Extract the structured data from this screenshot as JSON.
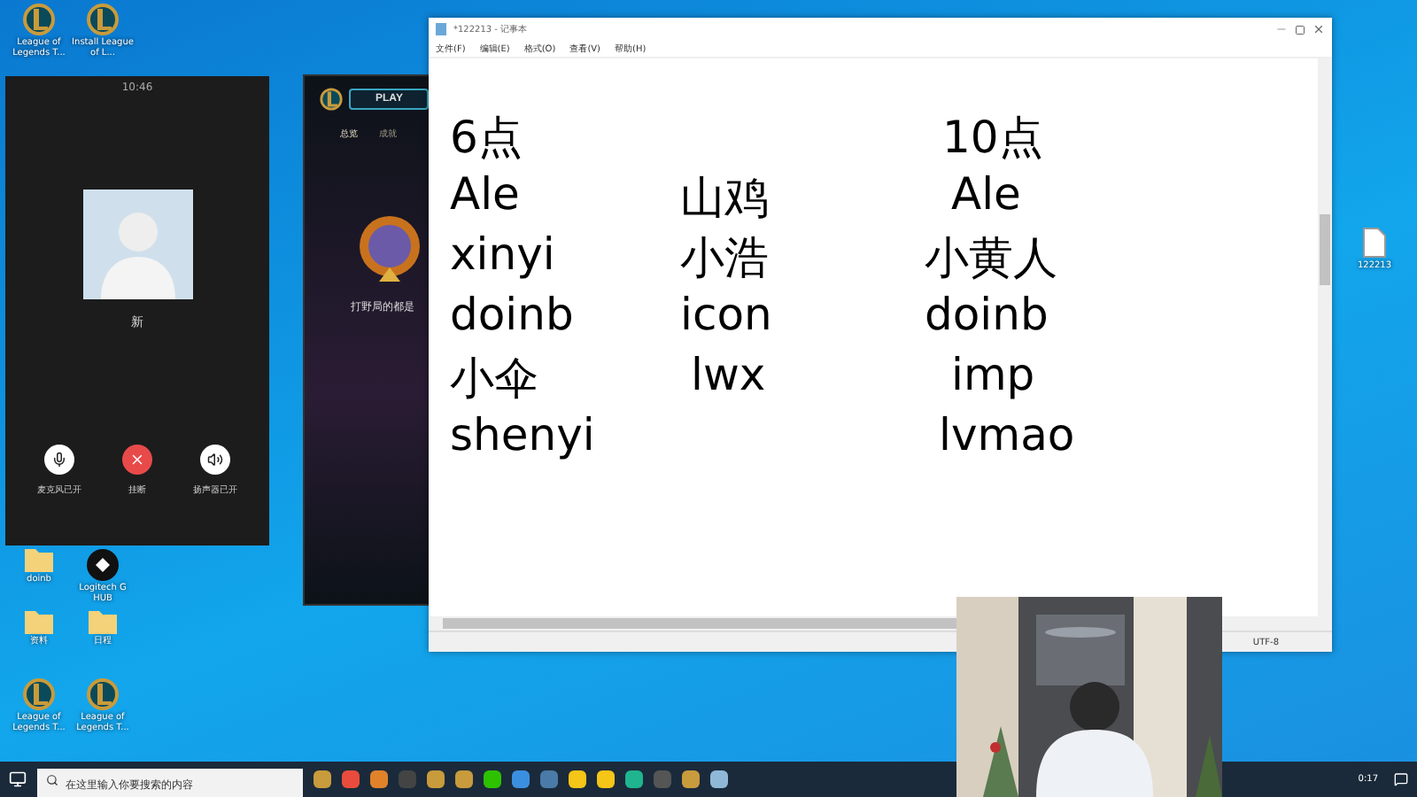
{
  "desktop_icons": [
    {
      "label": "League of Legends T...",
      "kind": "lol"
    },
    {
      "label": "Install League of L...",
      "kind": "lol"
    },
    {
      "label": "doinb",
      "kind": "folder"
    },
    {
      "label": "Logitech G HUB",
      "kind": "app"
    },
    {
      "label": "资料",
      "kind": "folder"
    },
    {
      "label": "日程",
      "kind": "folder"
    },
    {
      "label": "League of Legends T...",
      "kind": "lol"
    },
    {
      "label": "League of Legends T...",
      "kind": "lol"
    },
    {
      "label": "122213",
      "kind": "file"
    }
  ],
  "call_window": {
    "title": "10:46",
    "name": "新",
    "controls": [
      {
        "label": "麦克风已开",
        "kind": "mic"
      },
      {
        "label": "挂断",
        "kind": "hangup"
      },
      {
        "label": "扬声器已开",
        "kind": "speaker"
      }
    ]
  },
  "game_client": {
    "play": "PLAY",
    "tabs": [
      {
        "label": "总览",
        "selected": true
      },
      {
        "label": "成就",
        "selected": false
      }
    ],
    "caption": "打野局的都是"
  },
  "notepad": {
    "title": "*122213 - 记事本",
    "menu": [
      "文件(F)",
      "编辑(E)",
      "格式(O)",
      "查看(V)",
      "帮助(H)"
    ],
    "lines": [
      {
        "column_1": "6点",
        "column_3": "10点"
      },
      {
        "column_1": "Ale",
        "column_2": "山鸡",
        "column_3": "Ale"
      },
      {
        "column_1": "xinyi",
        "column_2": "小浩",
        "column_3": "小黄人"
      },
      {
        "column_1": "doinb",
        "column_2": "icon",
        "column_3": "doinb"
      },
      {
        "column_1": "小伞",
        "column_2": "lwx",
        "column_3": "imp"
      },
      {
        "column_1": "shenyi",
        "column_3": "lvmao"
      }
    ],
    "encoding": "UTF-8"
  },
  "taskbar": {
    "search": {
      "placeholder": "在这里输入你要搜索的内容"
    },
    "apps": [
      {
        "color": "#c89b3c"
      },
      {
        "color": "#e94b3c"
      },
      {
        "color": "#e0822a"
      },
      {
        "color": "#444444"
      },
      {
        "color": "#c89b3c"
      },
      {
        "color": "#c89b3c"
      },
      {
        "color": "#2dc100"
      },
      {
        "color": "#3b8fe0"
      },
      {
        "color": "#4a7aa8"
      },
      {
        "color": "#f5c518"
      },
      {
        "color": "#f5c518"
      },
      {
        "color": "#1fb58f"
      },
      {
        "color": "#555555"
      },
      {
        "color": "#c89b3c"
      },
      {
        "color": "#8fb8d8"
      }
    ],
    "clock": "0:17"
  }
}
